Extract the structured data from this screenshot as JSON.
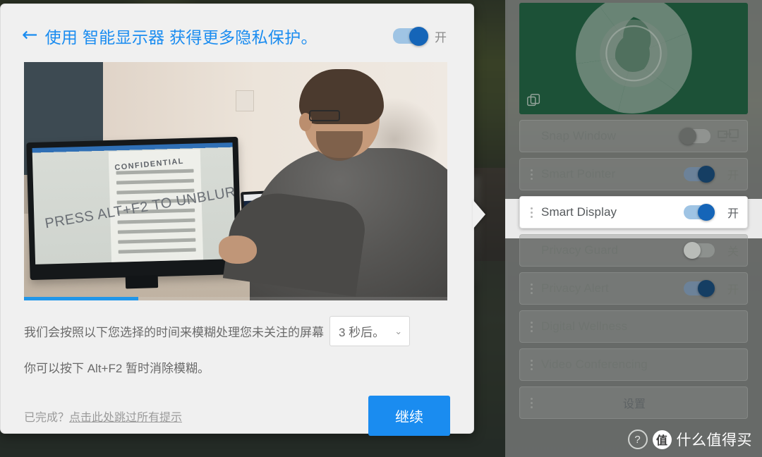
{
  "dialog": {
    "back_icon": "←",
    "title": "使用 智能显示器 获得更多隐私保护。",
    "header_toggle_state": "开",
    "video": {
      "monitor_watermark": "CONFIDENTIAL",
      "monitor_overlay_text": "PRESS ALT+F2 TO UNBLUR",
      "progress_percent": "27"
    },
    "description_1": "我们会按照以下您选择的时间来模糊处理您未关注的屏幕",
    "delay_select_value": "3 秒后。",
    "select_chevron": "⌄",
    "description_2": "你可以按下 Alt+F2 暂时消除模糊。",
    "skip_prefix": "已完成？",
    "skip_link": "点击此处跳过所有提示",
    "continue_label": "继续"
  },
  "panel": {
    "rows": [
      {
        "label": "Snap Window",
        "toggle": "off",
        "state": "",
        "has_snap_icon": true,
        "dimmed": true,
        "active": false,
        "handle": false
      },
      {
        "label": "Smart Pointer",
        "toggle": "on",
        "state": "开",
        "has_snap_icon": false,
        "dimmed": true,
        "active": false,
        "handle": true
      },
      {
        "label": "Smart Display",
        "toggle": "on",
        "state": "开",
        "has_snap_icon": false,
        "dimmed": false,
        "active": true,
        "handle": true
      },
      {
        "label": "Privacy Guard",
        "toggle": "off",
        "state": "关",
        "has_snap_icon": false,
        "dimmed": true,
        "active": false,
        "handle": false
      },
      {
        "label": "Privacy Alert",
        "toggle": "on",
        "state": "开",
        "has_snap_icon": false,
        "dimmed": true,
        "active": false,
        "handle": true
      },
      {
        "label": "Digital Wellness",
        "toggle": "none",
        "state": "",
        "has_snap_icon": false,
        "dimmed": true,
        "active": false,
        "handle": true
      },
      {
        "label": "Video Conferencing",
        "toggle": "none",
        "state": "",
        "has_snap_icon": false,
        "dimmed": true,
        "active": false,
        "handle": true
      },
      {
        "label": "设置",
        "toggle": "none",
        "state": "",
        "has_snap_icon": false,
        "dimmed": true,
        "active": false,
        "handle": true,
        "centered": true
      }
    ]
  },
  "watermark": {
    "help_glyph": "?",
    "logo_char": "值",
    "text": "什么值得买"
  },
  "colors": {
    "accent_blue": "#1a8cf0",
    "toggle_on": "#1565b8",
    "hero_green": "#1c5137",
    "progress_blue": "#2196e8"
  }
}
